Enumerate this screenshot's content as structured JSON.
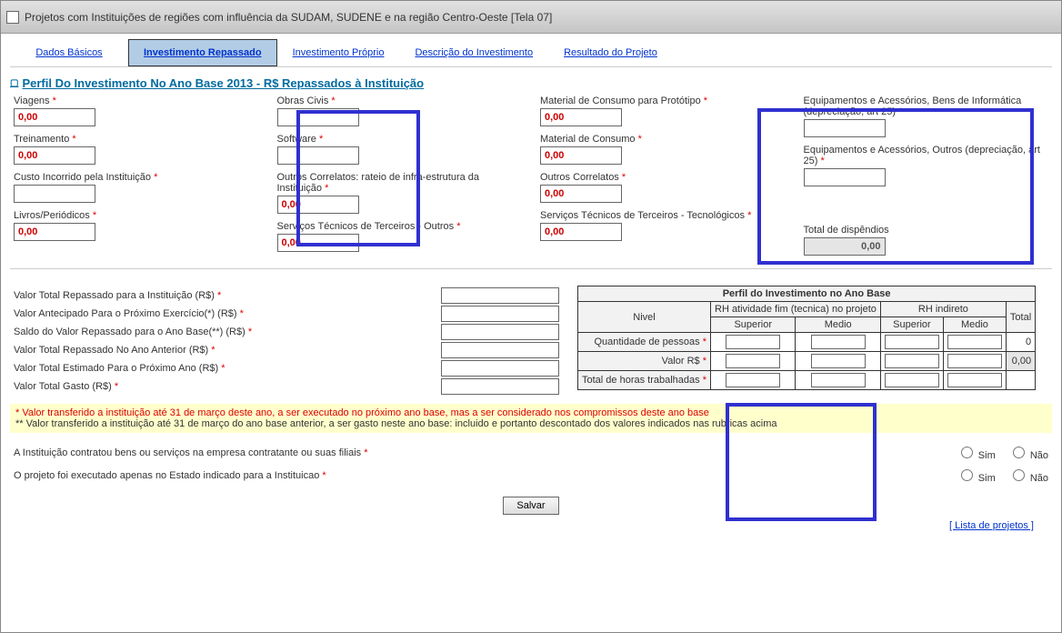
{
  "window": {
    "title": "Projetos com Instituições de regiões com influência da SUDAM, SUDENE e na região Centro-Oeste [Tela 07]"
  },
  "tabs": [
    {
      "label": "Dados Básicos",
      "active": false
    },
    {
      "label": "Investimento Repassado",
      "active": true
    },
    {
      "label": "Investimento Próprio",
      "active": false
    },
    {
      "label": "Descrição do Investimento",
      "active": false
    },
    {
      "label": "Resultado do Projeto",
      "active": false
    }
  ],
  "section_title": "Perfil Do Investimento No Ano Base 2013 - R$ Repassados à Instituição",
  "fields": {
    "viagens": {
      "label": "Viagens",
      "value": "0,00"
    },
    "treinamento": {
      "label": "Treinamento",
      "value": "0,00"
    },
    "custo_inst": {
      "label": "Custo Incorrido pela Instituição",
      "value": ""
    },
    "livros": {
      "label": "Livros/Periódicos",
      "value": "0,00"
    },
    "obras": {
      "label": "Obras Civis",
      "value": ""
    },
    "software": {
      "label": "Software",
      "value": ""
    },
    "correlatos_rateio": {
      "label": "Outros Correlatos: rateio de infra-estrutura da Instituição",
      "value": "0,00"
    },
    "serv_outros": {
      "label": "Serviços Técnicos de Terceiros - Outros",
      "value": "0,00"
    },
    "mat_prototipo": {
      "label": "Material de Consumo para Protótipo",
      "value": "0,00"
    },
    "mat_consumo": {
      "label": "Material de Consumo",
      "value": "0,00"
    },
    "correlatos": {
      "label": "Outros Correlatos",
      "value": "0,00"
    },
    "serv_tec": {
      "label": "Serviços Técnicos de Terceiros - Tecnológicos",
      "value": "0,00"
    },
    "equip_info": {
      "label": "Equipamentos e Acessórios, Bens de Informática (depreciação, art 25)",
      "value": ""
    },
    "equip_outros": {
      "label": "Equipamentos e Acessórios, Outros (depreciação, art 25)",
      "value": ""
    },
    "total_disp": {
      "label": "Total de dispêndios",
      "value": "0,00"
    }
  },
  "totals": [
    {
      "label": "Valor Total Repassado para a Instituição (R$)",
      "req": true
    },
    {
      "label": "Valor Antecipado Para o Próximo Exercício(*) (R$)",
      "req": true
    },
    {
      "label": "Saldo do Valor Repassado para o Ano Base(**) (R$)",
      "req": true
    },
    {
      "label": "Valor Total Repassado No Ano Anterior (R$)",
      "req": true
    },
    {
      "label": "Valor Total Estimado Para o Próximo Ano (R$)",
      "req": true
    },
    {
      "label": "Valor Total Gasto (R$)",
      "req": true
    }
  ],
  "rh_table": {
    "title": "Perfil do Investimento no Ano Base",
    "col_groups": [
      "RH atividade fim (tecnica) no projeto",
      "RH indireto",
      "Total"
    ],
    "row_header": "Nivel",
    "sub_cols": [
      "Superior",
      "Medio",
      "Superior",
      "Medio"
    ],
    "rows": [
      {
        "label": "Quantidade de pessoas",
        "req": true,
        "total": "0"
      },
      {
        "label": "Valor R$",
        "req": true,
        "total": "0,00"
      },
      {
        "label": "Total de horas trabalhadas",
        "req": true,
        "total": ""
      }
    ]
  },
  "notes": {
    "n1": "* Valor transferido a instituição até 31 de março deste ano, a ser executado no próximo ano base, mas a ser considerado nos compromissos deste ano base",
    "n2": "** Valor transferido a instituição até 31 de março do ano base anterior, a ser gasto neste ano base: incluido e portanto descontado dos valores indicados nas rubricas acima"
  },
  "questions": [
    {
      "text": "A Instituição contratou bens ou serviços na empresa contratante ou suas filiais",
      "yes": "Sim",
      "no": "Não"
    },
    {
      "text": "O projeto foi executado apenas no Estado indicado para a Instituicao",
      "yes": "Sim",
      "no": "Não"
    }
  ],
  "buttons": {
    "save": "Salvar"
  },
  "links": {
    "lista": "[ Lista de projetos ]"
  }
}
